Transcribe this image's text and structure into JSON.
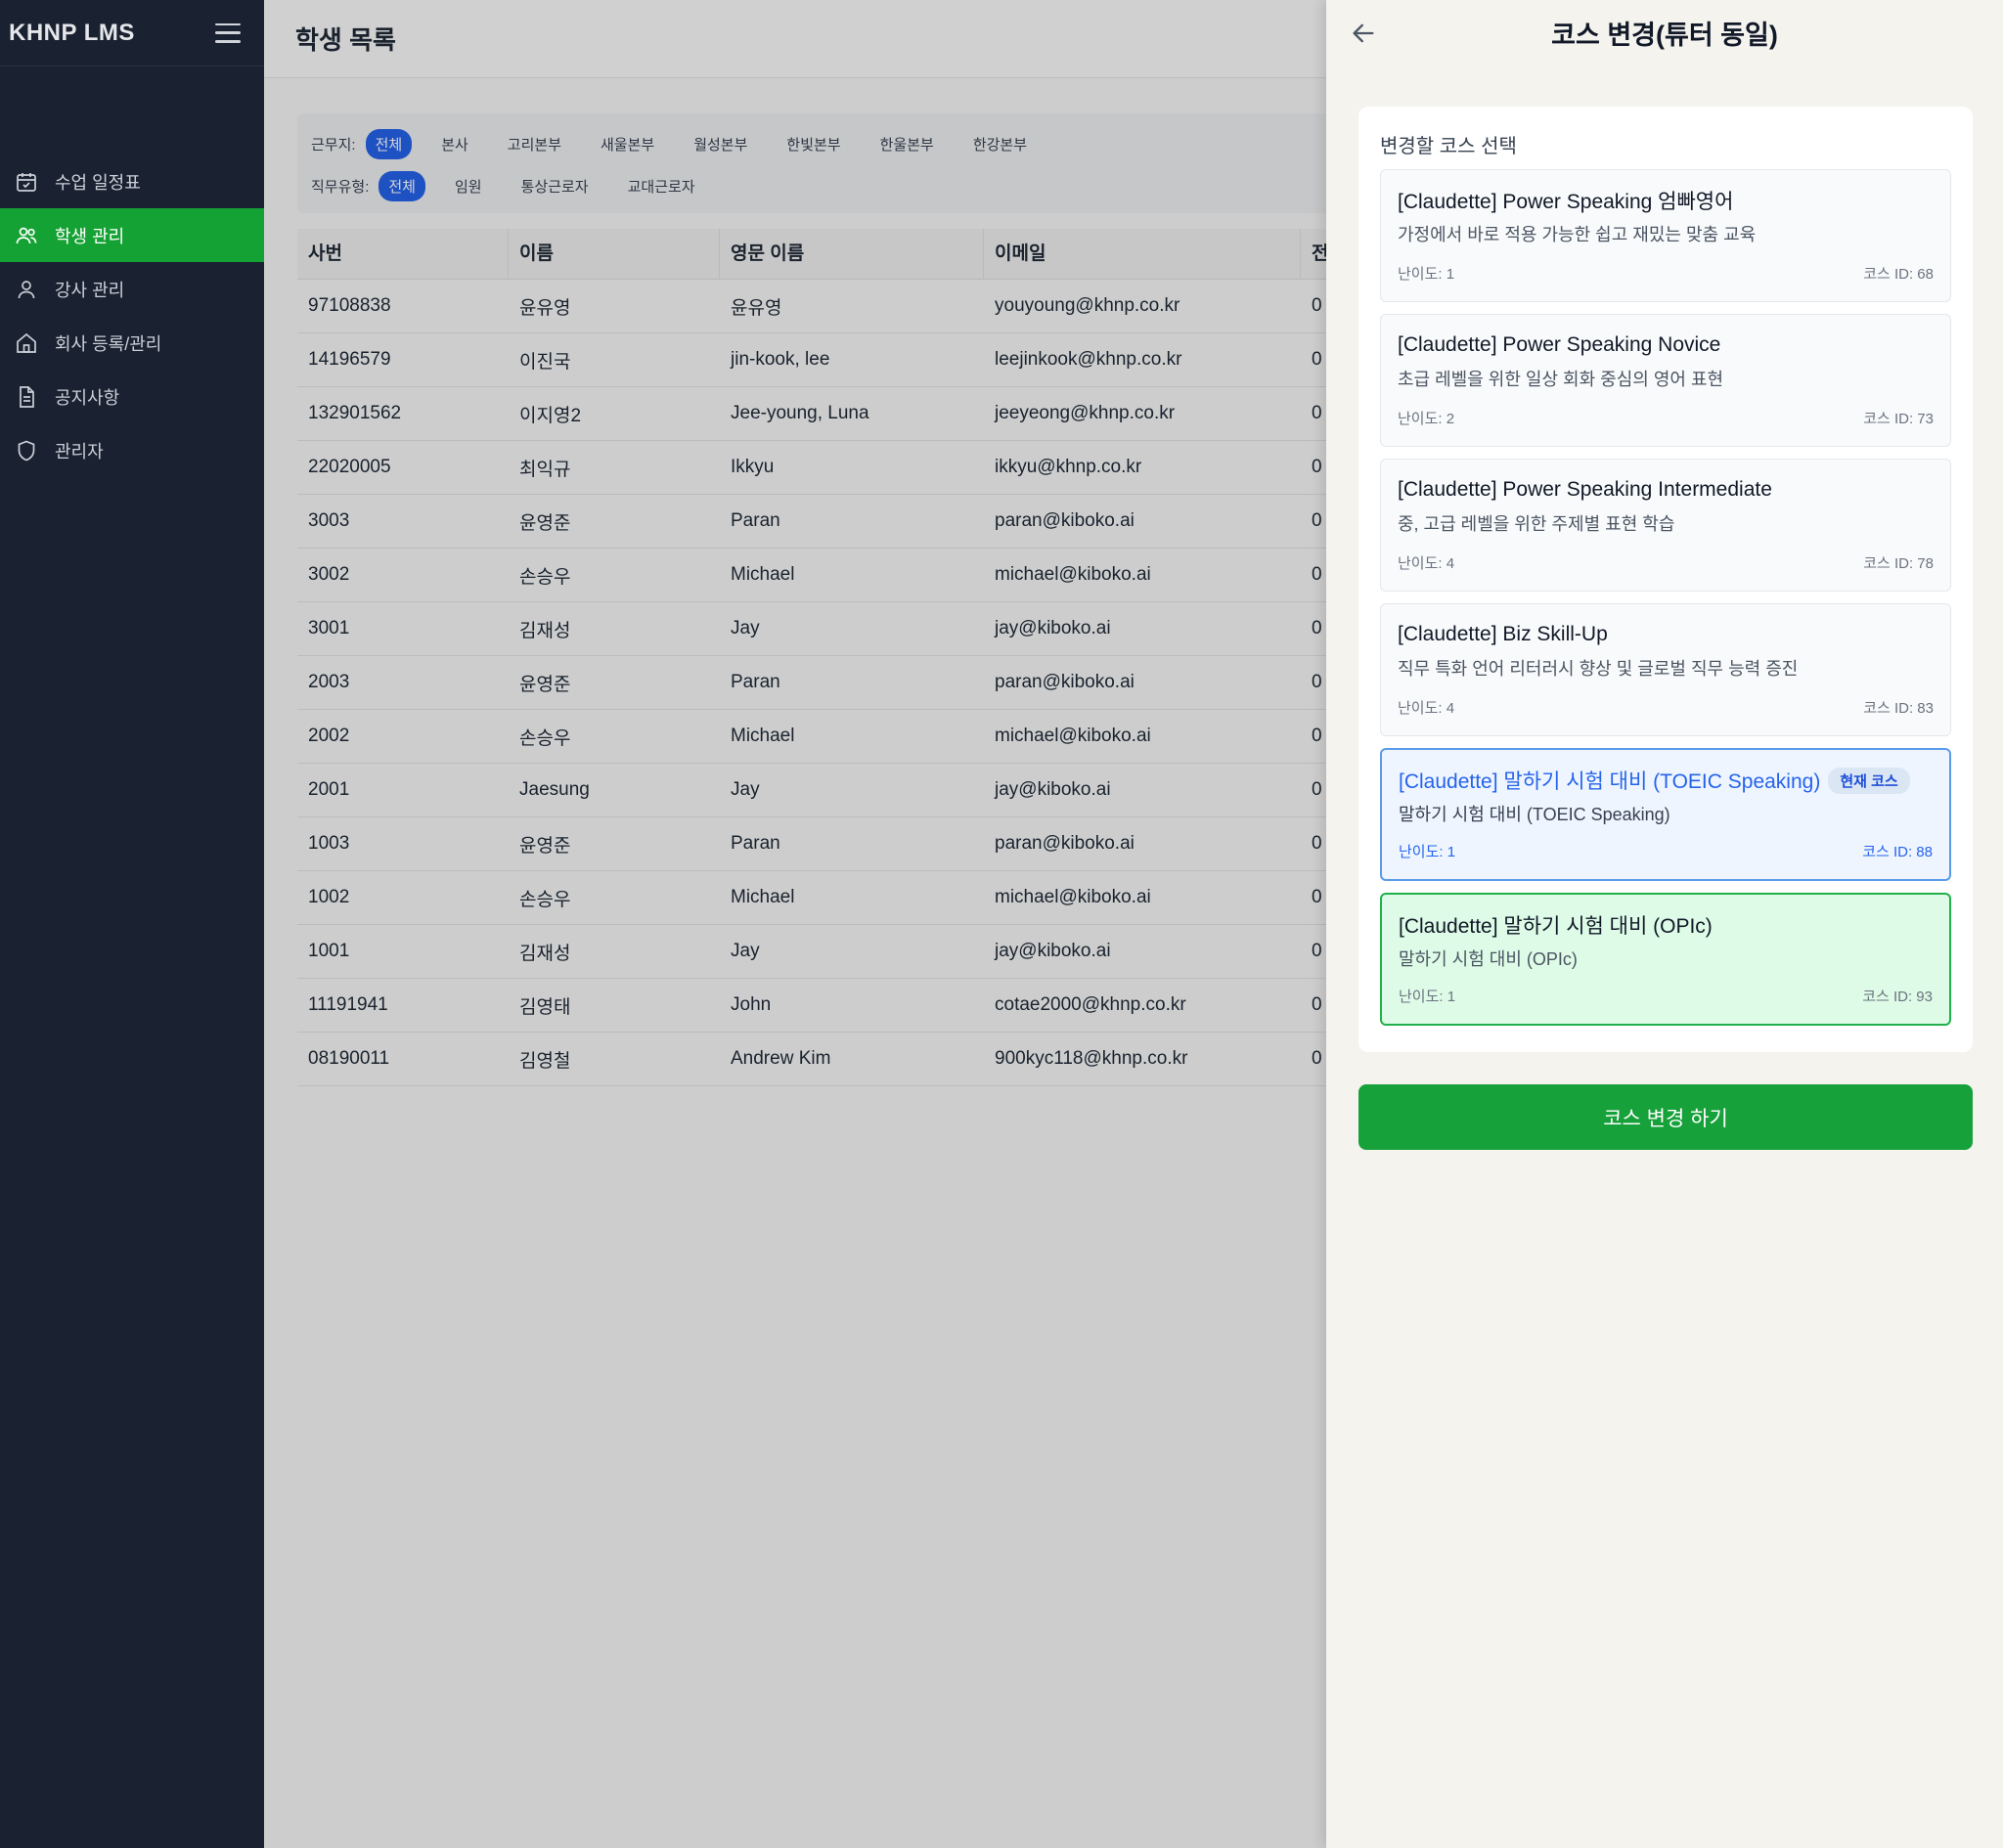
{
  "sidebar": {
    "logo": "KHNP LMS",
    "items": [
      {
        "label": "수업 일정표",
        "icon": "calendar-icon"
      },
      {
        "label": "학생 관리",
        "icon": "users-icon",
        "active": true
      },
      {
        "label": "강사 관리",
        "icon": "user-icon"
      },
      {
        "label": "회사 등록/관리",
        "icon": "home-icon"
      },
      {
        "label": "공지사항",
        "icon": "document-icon"
      },
      {
        "label": "관리자",
        "icon": "shield-icon"
      }
    ]
  },
  "main": {
    "title": "학생 목록",
    "filters": {
      "location_label": "근무지:",
      "locations": [
        "전체",
        "본사",
        "고리본부",
        "새울본부",
        "월성본부",
        "한빛본부",
        "한울본부",
        "한강본부"
      ],
      "location_selected": "전체",
      "jobtype_label": "직무유형:",
      "jobtypes": [
        "전체",
        "임원",
        "통상근로자",
        "교대근로자"
      ],
      "jobtype_selected": "전체"
    },
    "table": {
      "headers": [
        "사번",
        "이름",
        "영문 이름",
        "이메일",
        "전"
      ],
      "rows": [
        [
          "97108838",
          "윤유영",
          "윤유영",
          "youyoung@khnp.co.kr",
          "0"
        ],
        [
          "14196579",
          "이진국",
          "jin-kook, lee",
          "leejinkook@khnp.co.kr",
          "0"
        ],
        [
          "132901562",
          "이지영2",
          "Jee-young, Luna",
          "jeeyeong@khnp.co.kr",
          "0"
        ],
        [
          "22020005",
          "최익규",
          "Ikkyu",
          "ikkyu@khnp.co.kr",
          "0"
        ],
        [
          "3003",
          "윤영준",
          "Paran",
          "paran@kiboko.ai",
          "0"
        ],
        [
          "3002",
          "손승우",
          "Michael",
          "michael@kiboko.ai",
          "0"
        ],
        [
          "3001",
          "김재성",
          "Jay",
          "jay@kiboko.ai",
          "0"
        ],
        [
          "2003",
          "윤영준",
          "Paran",
          "paran@kiboko.ai",
          "0"
        ],
        [
          "2002",
          "손승우",
          "Michael",
          "michael@kiboko.ai",
          "0"
        ],
        [
          "2001",
          "Jaesung",
          "Jay",
          "jay@kiboko.ai",
          "0"
        ],
        [
          "1003",
          "윤영준",
          "Paran",
          "paran@kiboko.ai",
          "0"
        ],
        [
          "1002",
          "손승우",
          "Michael",
          "michael@kiboko.ai",
          "0"
        ],
        [
          "1001",
          "김재성",
          "Jay",
          "jay@kiboko.ai",
          "0"
        ],
        [
          "11191941",
          "김영태",
          "John",
          "cotae2000@khnp.co.kr",
          "0"
        ],
        [
          "08190011",
          "김영철",
          "Andrew Kim",
          "900kyc118@khnp.co.kr",
          "0"
        ]
      ]
    }
  },
  "panel": {
    "title": "코스 변경(튜터 동일)",
    "section_title": "변경할 코스 선택",
    "courses": [
      {
        "name": "[Claudette] Power Speaking 엄빠영어",
        "desc": "가정에서 바로 적용 가능한 쉽고 재밌는 맞춤 교육",
        "level": "난이도: 1",
        "course_id": "코스 ID: 68",
        "state": "normal"
      },
      {
        "name": "[Claudette] Power Speaking Novice",
        "desc": "초급 레벨을 위한 일상 회화 중심의 영어 표현",
        "level": "난이도: 2",
        "course_id": "코스 ID: 73",
        "state": "normal"
      },
      {
        "name": "[Claudette] Power Speaking Intermediate",
        "desc": "중, 고급 레벨을 위한 주제별 표현 학습",
        "level": "난이도: 4",
        "course_id": "코스 ID: 78",
        "state": "normal"
      },
      {
        "name": "[Claudette] Biz Skill-Up",
        "desc": "직무 특화 언어 리터러시 향상 및 글로벌 직무 능력 증진",
        "level": "난이도: 4",
        "course_id": "코스 ID: 83",
        "state": "normal"
      },
      {
        "name": "[Claudette] 말하기 시험 대비 (TOEIC Speaking)",
        "desc": "말하기 시험 대비 (TOEIC Speaking)",
        "level": "난이도: 1",
        "course_id": "코스 ID: 88",
        "state": "current",
        "badge": "현재 코스"
      },
      {
        "name": "[Claudette] 말하기 시험 대비 (OPIc)",
        "desc": "말하기 시험 대비 (OPIc)",
        "level": "난이도: 1",
        "course_id": "코스 ID: 93",
        "state": "selected"
      }
    ],
    "submit_label": "코스 변경 하기"
  },
  "colors": {
    "sidebar_bg": "#1a2130",
    "active_green": "#15a234",
    "primary_blue": "#2563eb",
    "current_border": "#5a9be8",
    "selected_border": "#22b04b"
  }
}
